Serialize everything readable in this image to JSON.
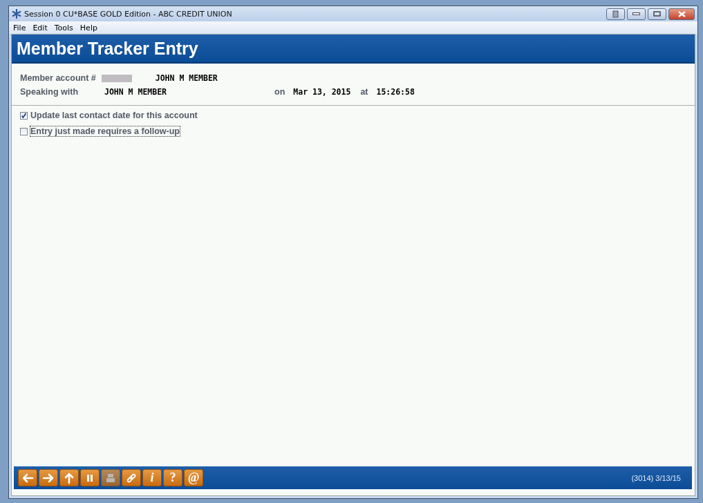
{
  "window": {
    "title": "Session 0 CU*BASE GOLD Edition - ABC CREDIT UNION"
  },
  "menu": [
    "File",
    "Edit",
    "Tools",
    "Help"
  ],
  "header": {
    "title": "Member Tracker Entry"
  },
  "member": {
    "account_label": "Member account #",
    "account_name": "JOHN M MEMBER",
    "speaking_label": "Speaking with",
    "speaking_name": "JOHN M MEMBER",
    "on_label": "on",
    "date": "Mar 13, 2015",
    "at_label": "at",
    "time": "15:26:58"
  },
  "options": [
    {
      "label": "Update last contact date for this account",
      "checked": true,
      "focused": false
    },
    {
      "label": "Entry just made requires a follow-up",
      "checked": false,
      "focused": true
    }
  ],
  "toolbar": [
    {
      "kind": "back"
    },
    {
      "kind": "forward"
    },
    {
      "kind": "up"
    },
    {
      "kind": "pause"
    },
    {
      "kind": "print",
      "disabled": true
    },
    {
      "kind": "link"
    },
    {
      "kind": "text",
      "label": "i",
      "italic": true
    },
    {
      "kind": "text",
      "label": "?"
    },
    {
      "kind": "text",
      "label": "@"
    }
  ],
  "status": "(3014) 3/13/15"
}
